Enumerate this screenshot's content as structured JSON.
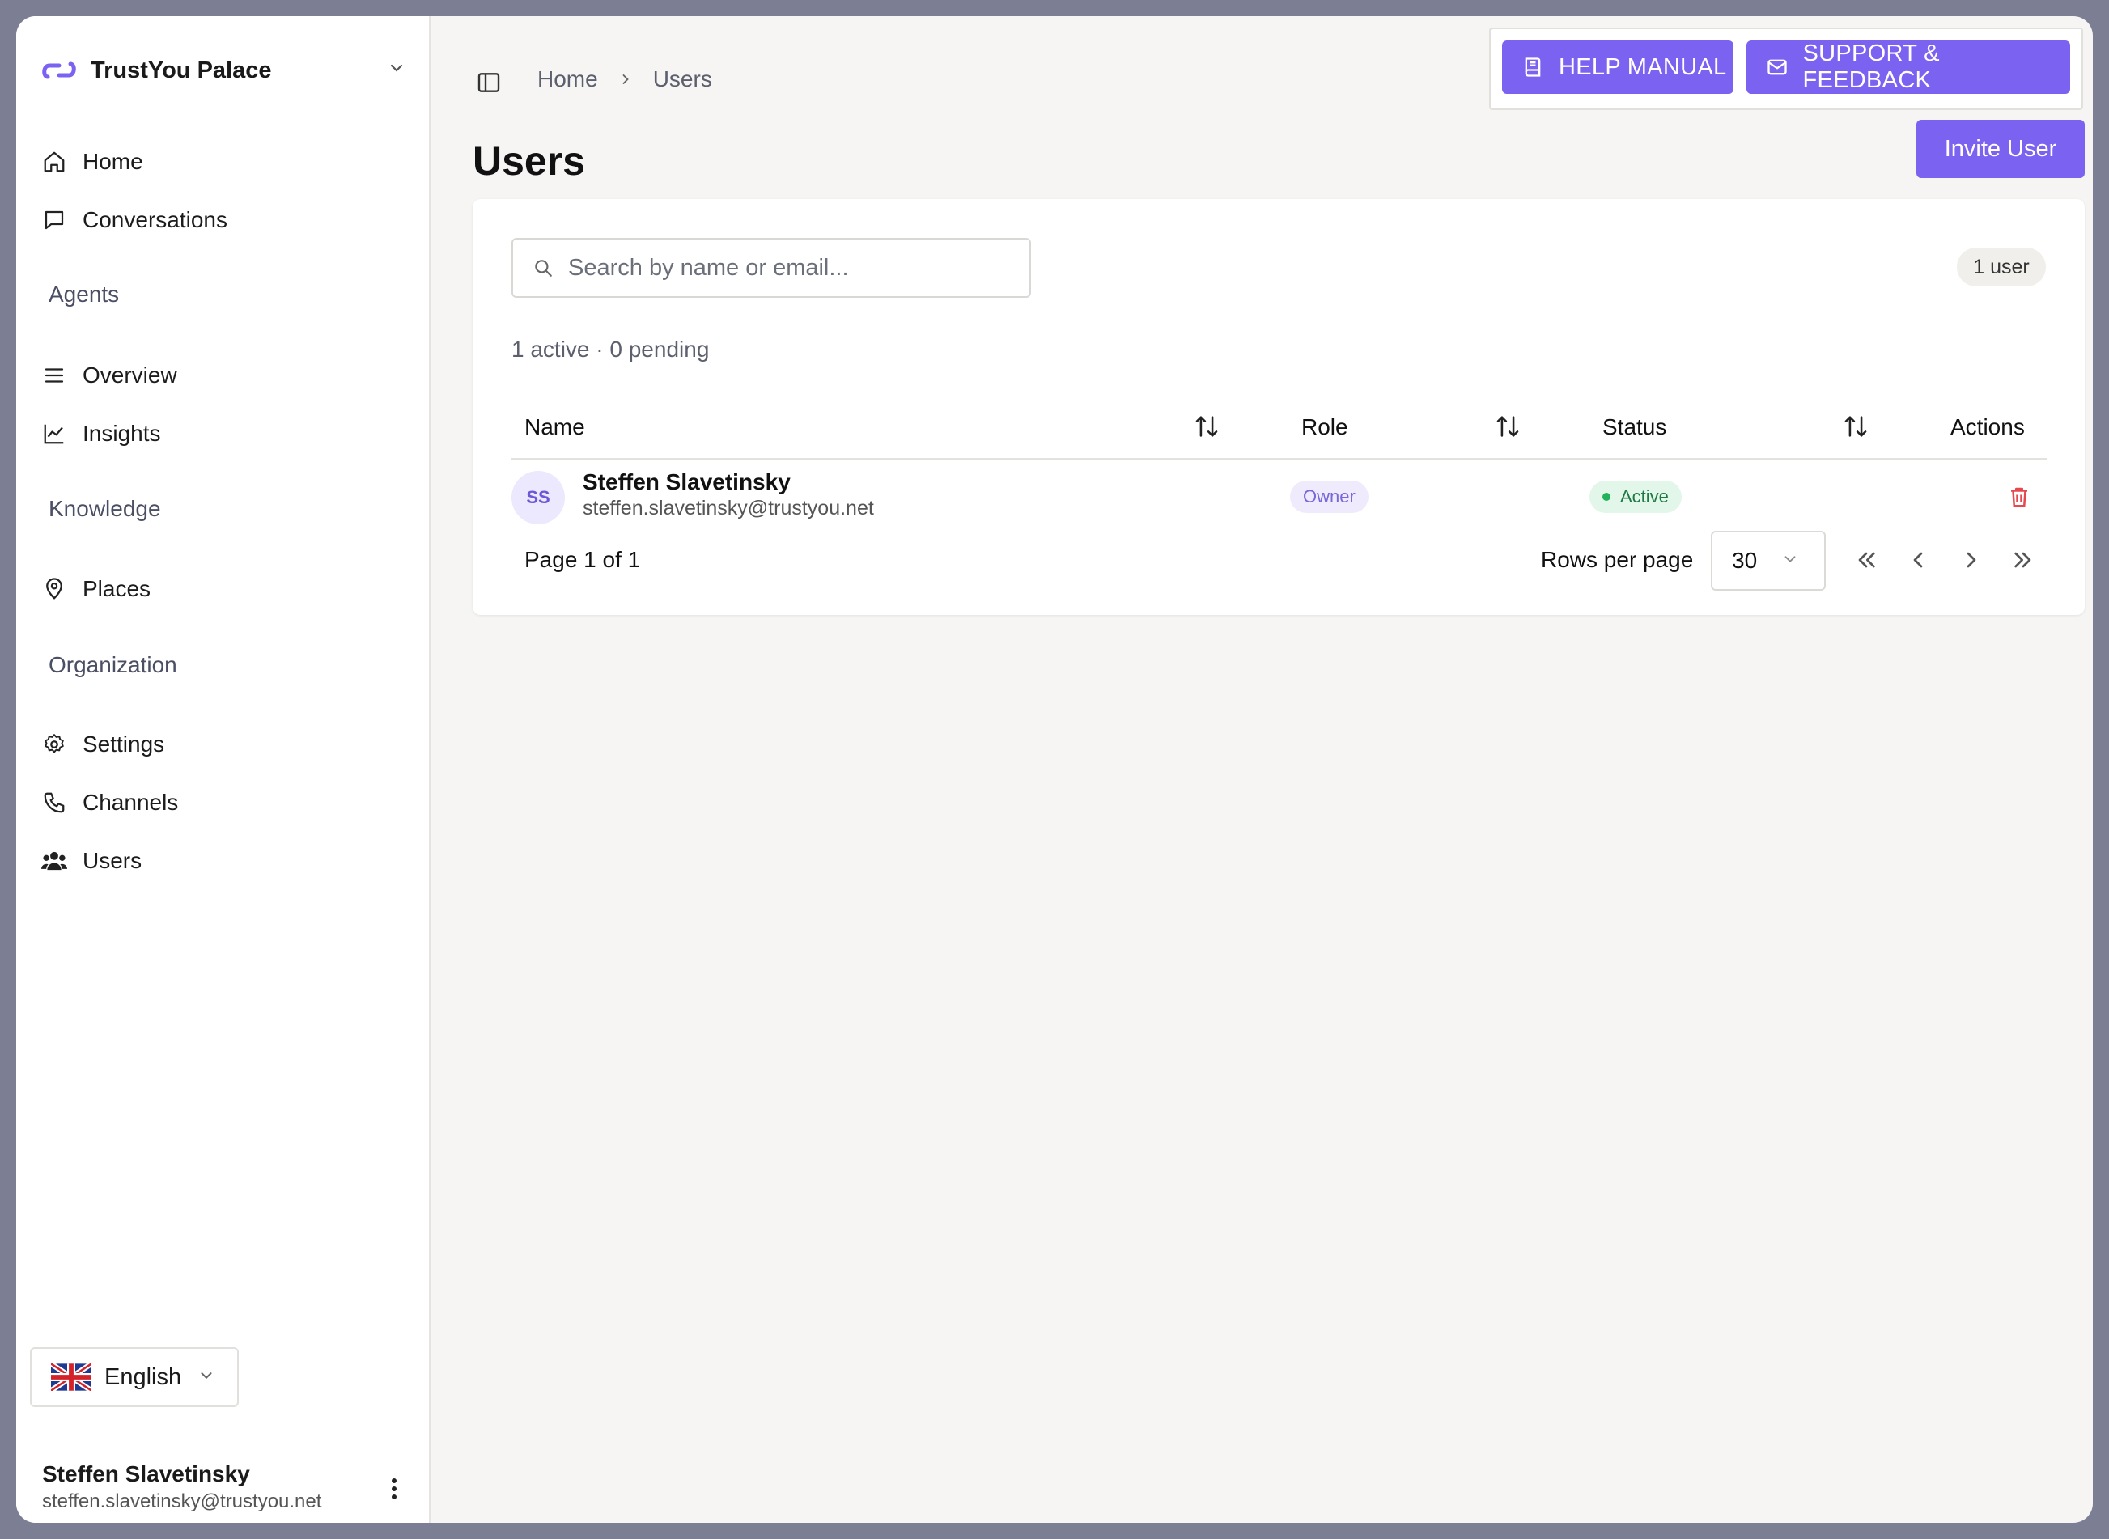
{
  "organization": {
    "name": "TrustYou Palace"
  },
  "sidebar": {
    "items": [
      {
        "label": "Home",
        "icon": "home-icon"
      },
      {
        "label": "Conversations",
        "icon": "message-square-icon"
      }
    ],
    "sections": [
      {
        "label": "Agents",
        "items": [
          {
            "label": "Overview",
            "icon": "list-icon"
          },
          {
            "label": "Insights",
            "icon": "line-chart-icon"
          }
        ]
      },
      {
        "label": "Knowledge",
        "items": [
          {
            "label": "Places",
            "icon": "map-pin-icon"
          }
        ]
      },
      {
        "label": "Organization",
        "items": [
          {
            "label": "Settings",
            "icon": "gear-icon"
          },
          {
            "label": "Channels",
            "icon": "phone-icon"
          },
          {
            "label": "Users",
            "icon": "users-icon"
          }
        ]
      }
    ],
    "language": {
      "label": "English",
      "flag": "uk-flag-icon"
    },
    "current_user": {
      "name": "Steffen Slavetinsky",
      "email": "steffen.slavetinsky@trustyou.net"
    }
  },
  "breadcrumb": {
    "home": "Home",
    "current": "Users"
  },
  "header_actions": {
    "help": "HELP MANUAL",
    "support": "SUPPORT & FEEDBACK"
  },
  "page": {
    "title": "Users",
    "invite_label": "Invite User"
  },
  "search": {
    "placeholder": "Search by name or email..."
  },
  "count_badge": "1 user",
  "summary": "1 active · 0 pending",
  "table": {
    "columns": {
      "name": "Name",
      "role": "Role",
      "status": "Status",
      "actions": "Actions"
    },
    "rows": [
      {
        "initials": "SS",
        "name": "Steffen Slavetinsky",
        "email": "steffen.slavetinsky@trustyou.net",
        "role": "Owner",
        "status": "Active"
      }
    ]
  },
  "pagination": {
    "page_info": "Page 1 of 1",
    "rows_per_page_label": "Rows per page",
    "rows_per_page": "30"
  },
  "colors": {
    "accent": "#7c62f0",
    "danger": "#e5484d",
    "success": "#22b25a"
  }
}
